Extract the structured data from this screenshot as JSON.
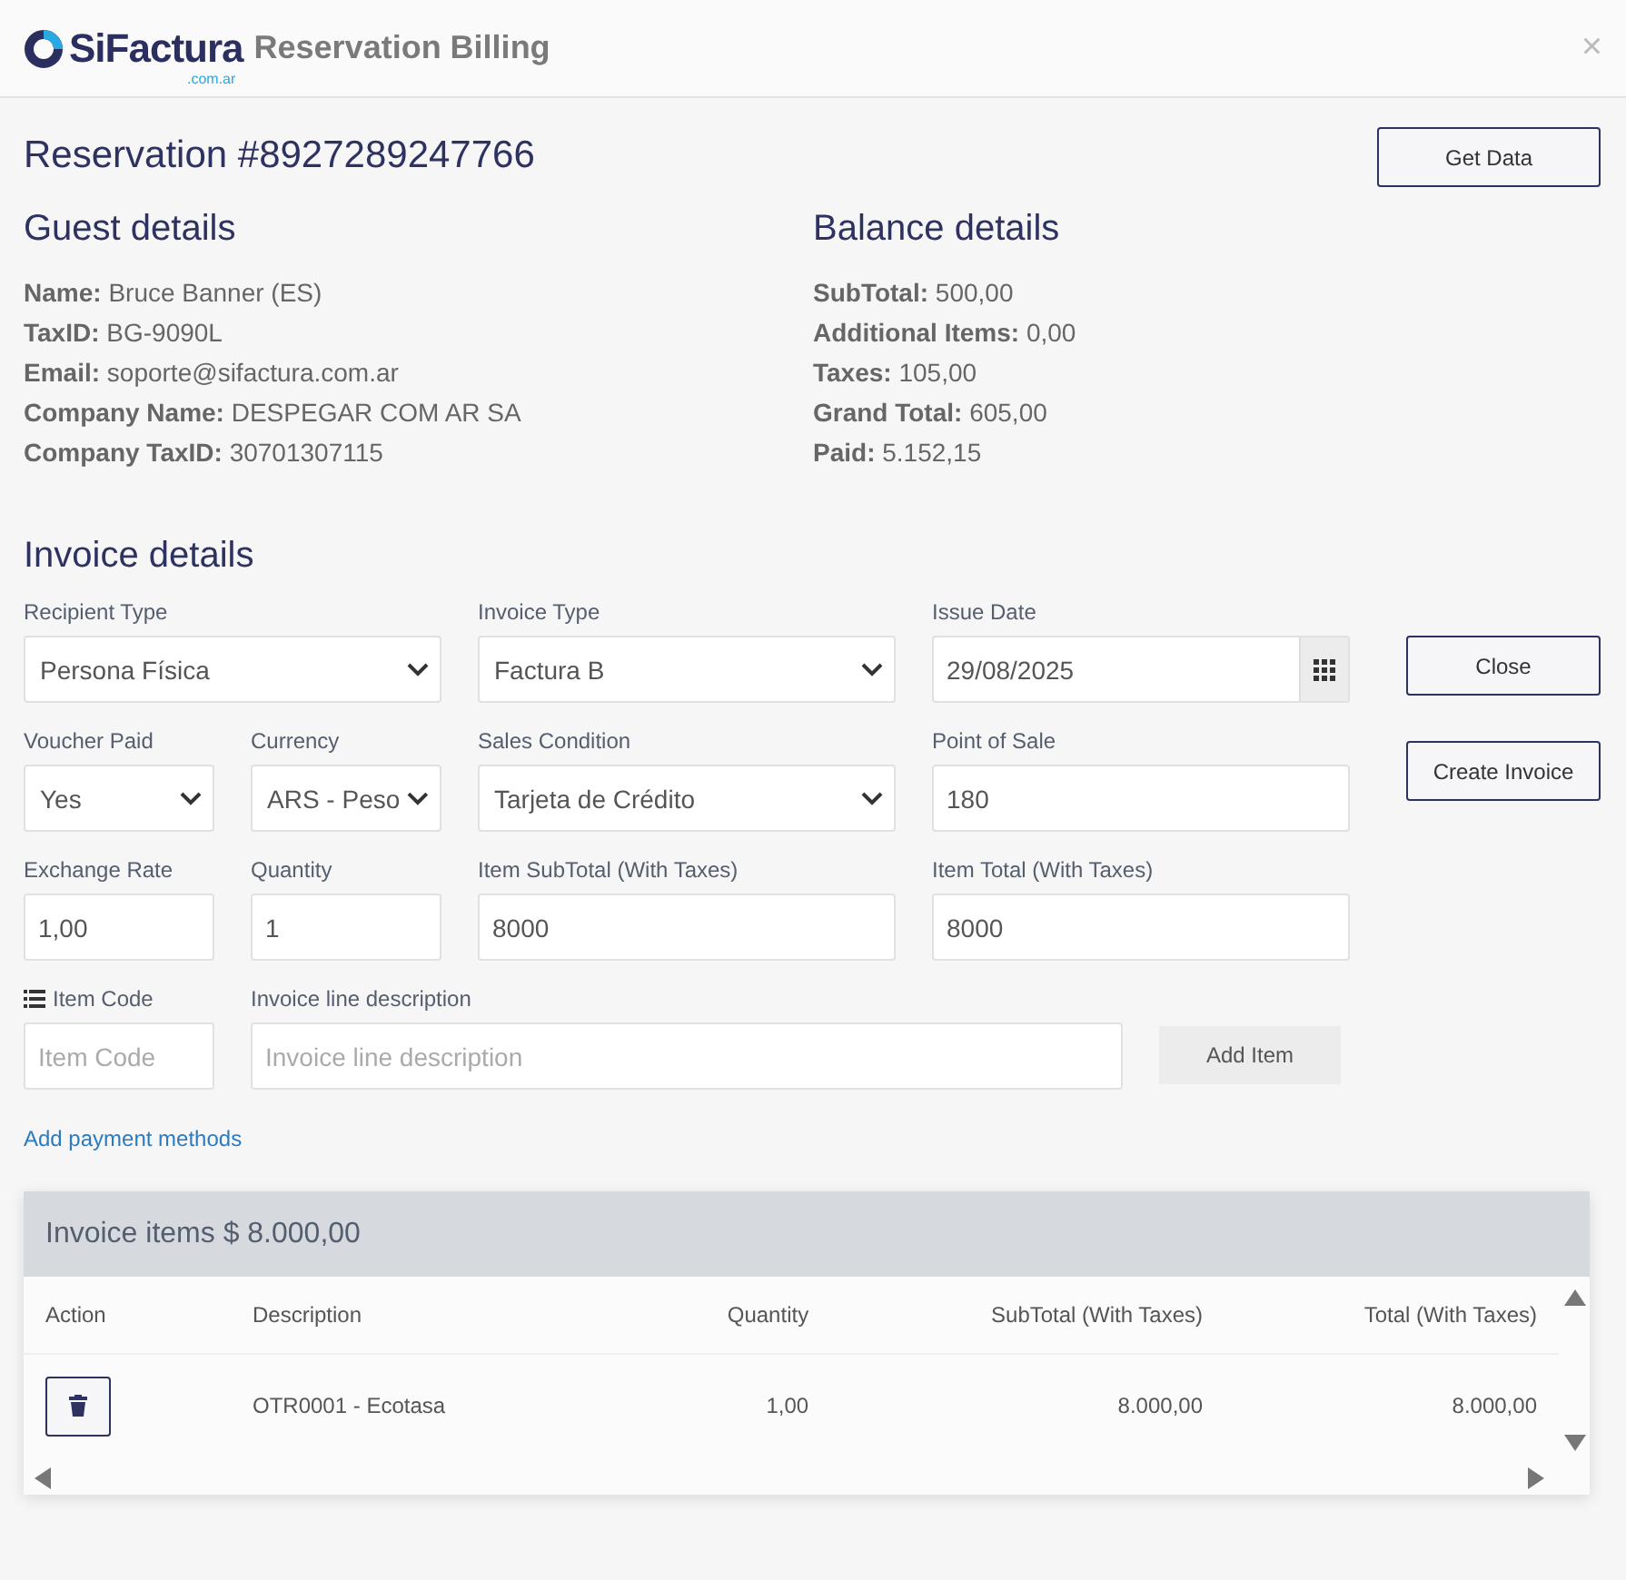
{
  "header": {
    "logo": "SiFactura",
    "logo_sub": ".com.ar",
    "title": "Reservation Billing",
    "close": "×"
  },
  "reservation": {
    "title": "Reservation #8927289247766",
    "button": "Get Data"
  },
  "guest": {
    "title": "Guest details",
    "fields": [
      {
        "label": "Name:",
        "value": "Bruce Banner (ES)"
      },
      {
        "label": "TaxID:",
        "value": "BG-9090L"
      },
      {
        "label": "Email:",
        "value": "soporte@sifactura.com.ar"
      },
      {
        "label": "Company Name:",
        "value": "DESPEGAR COM AR SA"
      },
      {
        "label": "Company TaxID:",
        "value": "30701307115"
      }
    ]
  },
  "balance": {
    "title": "Balance details",
    "fields": [
      {
        "label": "SubTotal:",
        "value": "500,00"
      },
      {
        "label": "Additional Items:",
        "value": "0,00"
      },
      {
        "label": "Taxes:",
        "value": "105,00"
      },
      {
        "label": "Grand Total:",
        "value": "605,00"
      },
      {
        "label": "Paid:",
        "value": "5.152,15"
      }
    ]
  },
  "invoice": {
    "title": "Invoice details",
    "fields": [
      {
        "kind": "select",
        "label": "Recipient Type",
        "value": "Persona Física"
      },
      {
        "kind": "select",
        "label": "Invoice Type",
        "value": "Factura B"
      },
      {
        "kind": "date",
        "label": "Issue Date",
        "value": "29/08/2025"
      },
      {
        "kind": "select",
        "label": "Voucher Paid",
        "value": "Yes"
      },
      {
        "kind": "select",
        "label": "Currency",
        "value": "ARS - Peso"
      },
      {
        "kind": "select",
        "label": "Sales Condition",
        "value": "Tarjeta de Crédito"
      },
      {
        "kind": "text",
        "label": "Point of Sale",
        "value": "180"
      },
      {
        "kind": "text",
        "label": "Exchange Rate",
        "value": "1,00"
      },
      {
        "kind": "text",
        "label": "Quantity",
        "value": "1"
      },
      {
        "kind": "text",
        "label": "Item SubTotal (With Taxes)",
        "value": "8000"
      },
      {
        "kind": "text",
        "label": "Item Total (With Taxes)",
        "value": "8000"
      },
      {
        "kind": "code",
        "label": "Item Code",
        "placeholder": "Item Code"
      },
      {
        "kind": "text",
        "label": "Invoice line description",
        "placeholder": "Invoice line description"
      }
    ],
    "add_item": "Add Item",
    "side_buttons": [
      "Close",
      "Create Invoice"
    ],
    "payment_link": "Add payment methods"
  },
  "items": {
    "title": "Invoice items $ 8.000,00",
    "columns": [
      "Action",
      "Description",
      "Quantity",
      "SubTotal (With Taxes)",
      "Total (With Taxes)"
    ],
    "rows": [
      {
        "description": "OTR0001 - Ecotasa",
        "quantity": "1,00",
        "subtotal": "8.000,00",
        "total": "8.000,00"
      }
    ]
  }
}
